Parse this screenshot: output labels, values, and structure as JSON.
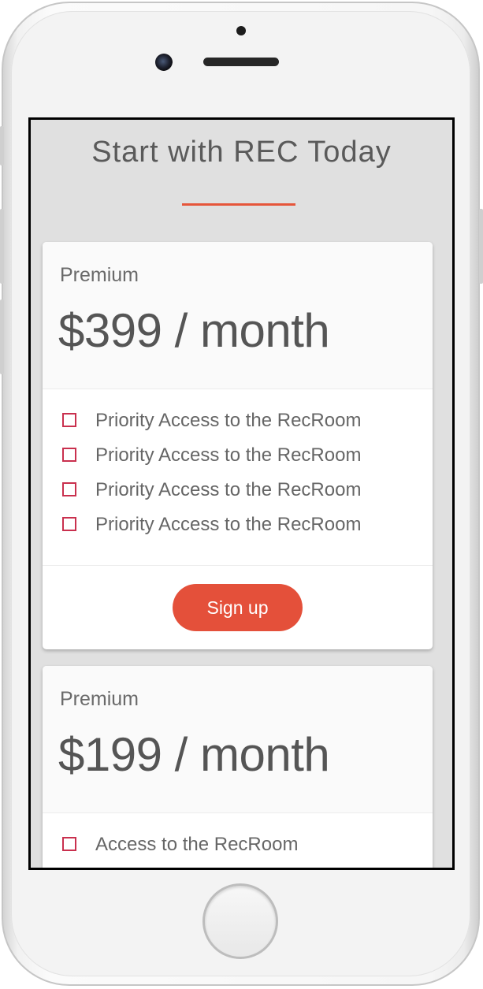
{
  "page": {
    "title": "Start with REC Today",
    "accent_color": "#e6553a",
    "checkbox_color": "#c9304e"
  },
  "plans": [
    {
      "name": "Premium",
      "price": "$399 / month",
      "features": [
        "Priority Access to the RecRoom",
        "Priority Access to the RecRoom",
        "Priority Access to the RecRoom",
        "Priority Access to the RecRoom"
      ],
      "button_label": "Sign up"
    },
    {
      "name": "Premium",
      "price": "$199 / month",
      "features": [
        "Access to the RecRoom"
      ]
    }
  ]
}
